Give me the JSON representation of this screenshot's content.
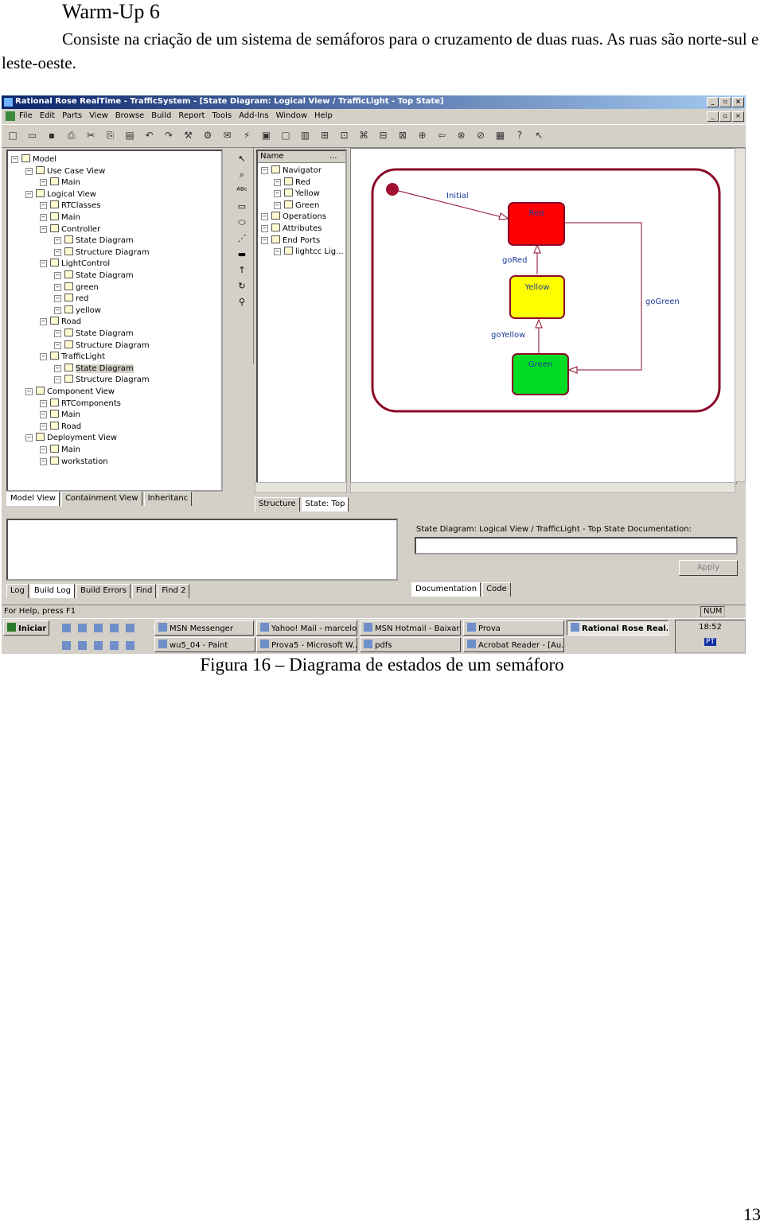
{
  "document": {
    "title": "Warm-Up 6",
    "paragraph": "Consiste na criação de um sistema de semáforos para o cruzamento de duas ruas. As ruas são norte-sul e leste-oeste.",
    "caption": "Figura 16 – Diagrama de estados de um semáforo",
    "page_number": "13"
  },
  "window": {
    "title": "Rational Rose RealTime - TrafficSystem - [State Diagram: Logical View / TrafficLight - Top State]",
    "controls": [
      "_",
      "▫",
      "×"
    ]
  },
  "menu": [
    "File",
    "Edit",
    "Parts",
    "View",
    "Browse",
    "Build",
    "Report",
    "Tools",
    "Add-Ins",
    "Window",
    "Help"
  ],
  "tree": [
    {
      "label": "Model",
      "depth": 0
    },
    {
      "label": "Use Case View",
      "depth": 1
    },
    {
      "label": "Main",
      "depth": 2
    },
    {
      "label": "Logical View",
      "depth": 1
    },
    {
      "label": "RTClasses",
      "depth": 2
    },
    {
      "label": "Main",
      "depth": 2
    },
    {
      "label": "Controller",
      "depth": 2
    },
    {
      "label": "State Diagram",
      "depth": 3
    },
    {
      "label": "Structure Diagram",
      "depth": 3
    },
    {
      "label": "LightControl",
      "depth": 2
    },
    {
      "label": "State Diagram",
      "depth": 3
    },
    {
      "label": "green",
      "depth": 3
    },
    {
      "label": "red",
      "depth": 3
    },
    {
      "label": "yellow",
      "depth": 3
    },
    {
      "label": "Road",
      "depth": 2
    },
    {
      "label": "State Diagram",
      "depth": 3
    },
    {
      "label": "Structure Diagram",
      "depth": 3
    },
    {
      "label": "TrafficLight",
      "depth": 2
    },
    {
      "label": "State Diagram",
      "depth": 3,
      "selected": true
    },
    {
      "label": "Structure Diagram",
      "depth": 3
    },
    {
      "label": "Component View",
      "depth": 1
    },
    {
      "label": "RTComponents",
      "depth": 2
    },
    {
      "label": "Main",
      "depth": 2
    },
    {
      "label": "Road",
      "depth": 2
    },
    {
      "label": "Deployment View",
      "depth": 1
    },
    {
      "label": "Main",
      "depth": 2
    },
    {
      "label": "workstation",
      "depth": 2
    }
  ],
  "tree_tabs": [
    "Model View",
    "Containment View",
    "Inheritanc"
  ],
  "navigator": {
    "header": "Name",
    "header_more": "...",
    "items": [
      {
        "label": "Navigator",
        "depth": 0
      },
      {
        "label": "Red",
        "depth": 1
      },
      {
        "label": "Yellow",
        "depth": 1
      },
      {
        "label": "Green",
        "depth": 1
      },
      {
        "label": "Operations",
        "depth": 0
      },
      {
        "label": "Attributes",
        "depth": 0
      },
      {
        "label": "End Ports",
        "depth": 0
      },
      {
        "label": "lightcc  Lig...",
        "depth": 1
      }
    ]
  },
  "diagram_tabs": [
    "Structure",
    "State: Top"
  ],
  "diagram": {
    "states": [
      {
        "name": "Red",
        "color": "#ff0000"
      },
      {
        "name": "Yellow",
        "color": "#ffff00"
      },
      {
        "name": "Green",
        "color": "#00dd22"
      }
    ],
    "transitions": [
      "Initial",
      "goRed",
      "goYellow",
      "goGreen"
    ],
    "border_color": "#8b0a2a",
    "label_color": "#1a3a9a"
  },
  "bottom": {
    "log_tabs": [
      "Log",
      "Build Log",
      "Build Errors",
      "Find",
      "Find 2"
    ],
    "doc_label": "State Diagram: Logical View / TrafficLight - Top State Documentation:",
    "apply": "Apply",
    "doc_tabs": [
      "Documentation",
      "Code"
    ]
  },
  "status": {
    "text": "For Help, press F1",
    "num": "NUM"
  },
  "taskbar": {
    "start": "Iniciar",
    "row1": [
      "MSN Messenger",
      "Yahoo! Mail - marcelo...",
      "MSN Hotmail - Baixar ...",
      "Prova",
      "Rational Rose Real..."
    ],
    "row2": [
      "wu5_04 - Paint",
      "Prova5 - Microsoft W...",
      "pdfs",
      "Acrobat Reader - [Au..."
    ],
    "clock": "18:52",
    "lang": "PT"
  }
}
